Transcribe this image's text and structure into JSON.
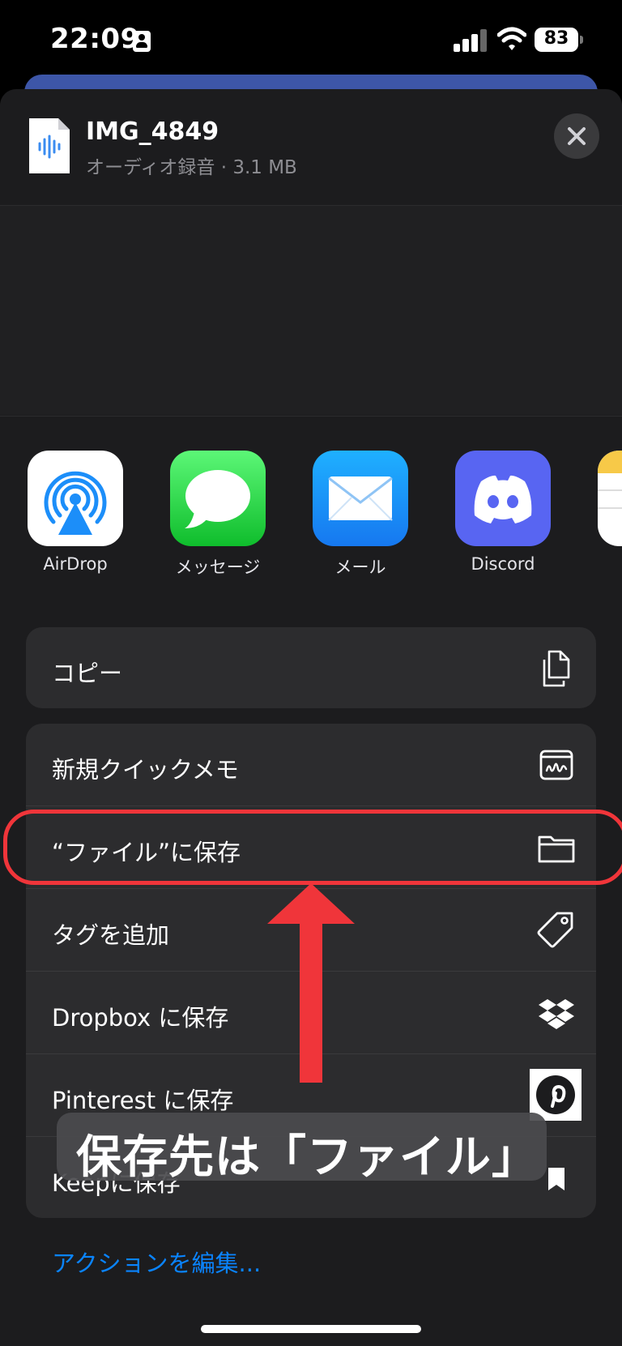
{
  "status": {
    "time": "22:09",
    "battery": "83"
  },
  "file": {
    "name": "IMG_4849",
    "meta": "オーディオ録音 · 3.1 MB"
  },
  "apps": [
    {
      "label": "AirDrop"
    },
    {
      "label": "メッセージ"
    },
    {
      "label": "メール"
    },
    {
      "label": "Discord"
    }
  ],
  "actions": {
    "copy": "コピー",
    "quick_memo": "新規クイックメモ",
    "save_to_files": "“ファイル”に保存",
    "add_tag": "タグを追加",
    "dropbox": "Dropbox に保存",
    "pinterest": "Pinterest に保存",
    "keep": "Keepに保存"
  },
  "edit_actions": "アクションを編集...",
  "caption": "保存先は「ファイル」",
  "colors": {
    "accent": "#0a84ff",
    "highlight": "#f0353a",
    "discord": "#5865f2"
  }
}
